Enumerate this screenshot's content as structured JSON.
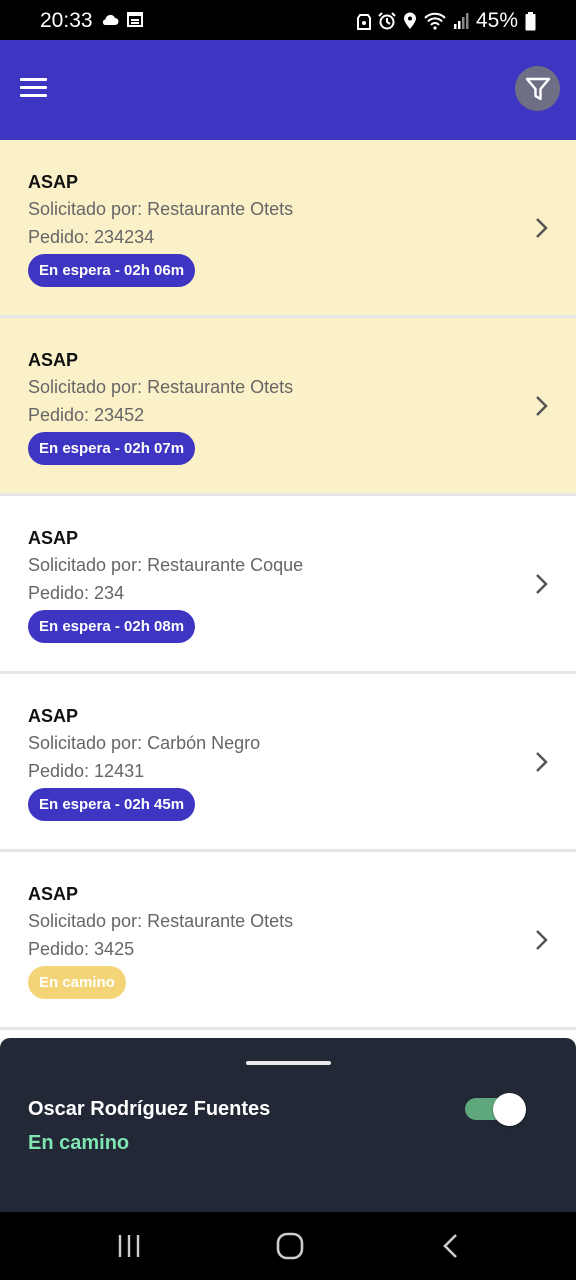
{
  "status_bar": {
    "time": "20:33",
    "battery": "45%"
  },
  "orders": [
    {
      "title": "ASAP",
      "requested_by": "Solicitado por: Restaurante Otets",
      "order": "Pedido: 234234",
      "badge": "En espera - 02h 06m",
      "badge_type": "waiting",
      "highlight": true
    },
    {
      "title": "ASAP",
      "requested_by": "Solicitado por: Restaurante Otets",
      "order": "Pedido: 23452",
      "badge": "En espera - 02h 07m",
      "badge_type": "waiting",
      "highlight": true
    },
    {
      "title": "ASAP",
      "requested_by": "Solicitado por: Restaurante Coque",
      "order": "Pedido: 234",
      "badge": "En espera - 02h 08m",
      "badge_type": "waiting",
      "highlight": false
    },
    {
      "title": "ASAP",
      "requested_by": "Solicitado por: Carbón Negro",
      "order": "Pedido: 12431",
      "badge": "En espera - 02h 45m",
      "badge_type": "waiting",
      "highlight": false
    },
    {
      "title": "ASAP",
      "requested_by": "Solicitado por: Restaurante Otets",
      "order": "Pedido: 3425",
      "badge": "En camino",
      "badge_type": "enroute",
      "highlight": false
    }
  ],
  "driver": {
    "name": "Oscar Rodríguez Fuentes",
    "status": "En camino",
    "active": true
  },
  "colors": {
    "primary": "#3e36c2",
    "highlight": "#fbf1c9",
    "enroute_badge": "#f3d577",
    "status_green": "#7fe3b2",
    "sheet": "#222836"
  },
  "icons": {
    "menu": "menu-icon",
    "filter": "filter-icon",
    "chevron": "chevron-right-icon"
  }
}
